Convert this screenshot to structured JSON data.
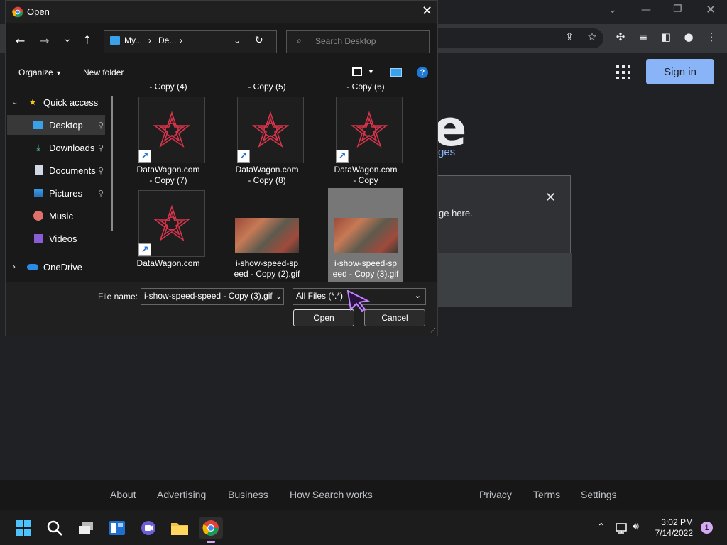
{
  "browser": {
    "signin_label": "Sign in",
    "google_logo_fragment": "e",
    "languages_fragment": "ges",
    "promo_text": "ge here.",
    "footer_links": [
      "About",
      "Advertising",
      "Business",
      "How Search works",
      "Privacy",
      "Terms",
      "Settings"
    ]
  },
  "dialog": {
    "title": "Open",
    "breadcrumb": [
      "My...",
      "De..."
    ],
    "search_placeholder": "Search Desktop",
    "organize_label": "Organize",
    "new_folder_label": "New folder",
    "sidebar": [
      {
        "label": "Quick access",
        "icon": "star-icon",
        "pinned": false
      },
      {
        "label": "Desktop",
        "icon": "desktop-icon",
        "pinned": true,
        "selected": true
      },
      {
        "label": "Downloads",
        "icon": "download-icon",
        "pinned": true
      },
      {
        "label": "Documents",
        "icon": "document-icon",
        "pinned": true
      },
      {
        "label": "Pictures",
        "icon": "pictures-icon",
        "pinned": true
      },
      {
        "label": "Music",
        "icon": "music-icon",
        "pinned": false
      },
      {
        "label": "Videos",
        "icon": "videos-icon",
        "pinned": false
      },
      {
        "label": "OneDrive",
        "icon": "cloud-icon",
        "pinned": false
      }
    ],
    "top_row_labels": [
      "- Copy (4)",
      "- Copy (5)",
      "- Copy (6)"
    ],
    "files": [
      {
        "line1": "DataWagon.com",
        "line2": "- Copy (7)",
        "kind": "shortcut"
      },
      {
        "line1": "DataWagon.com",
        "line2": "- Copy (8)",
        "kind": "shortcut"
      },
      {
        "line1": "DataWagon.com",
        "line2": "- Copy",
        "kind": "shortcut"
      },
      {
        "line1": "DataWagon.com",
        "line2": "",
        "kind": "shortcut"
      },
      {
        "line1": "i-show-speed-sp",
        "line2": "eed - Copy (2).gif",
        "kind": "photo"
      },
      {
        "line1": "i-show-speed-sp",
        "line2": "eed - Copy (3).gif",
        "kind": "photo",
        "selected": true
      }
    ],
    "file_name_label": "File name:",
    "file_name_value": "i-show-speed-speed - Copy (3).gif",
    "filter_value": "All Files (*.*)",
    "open_label": "Open",
    "cancel_label": "Cancel"
  },
  "taskbar": {
    "time": "3:02 PM",
    "date": "7/14/2022",
    "notification_count": "1"
  }
}
